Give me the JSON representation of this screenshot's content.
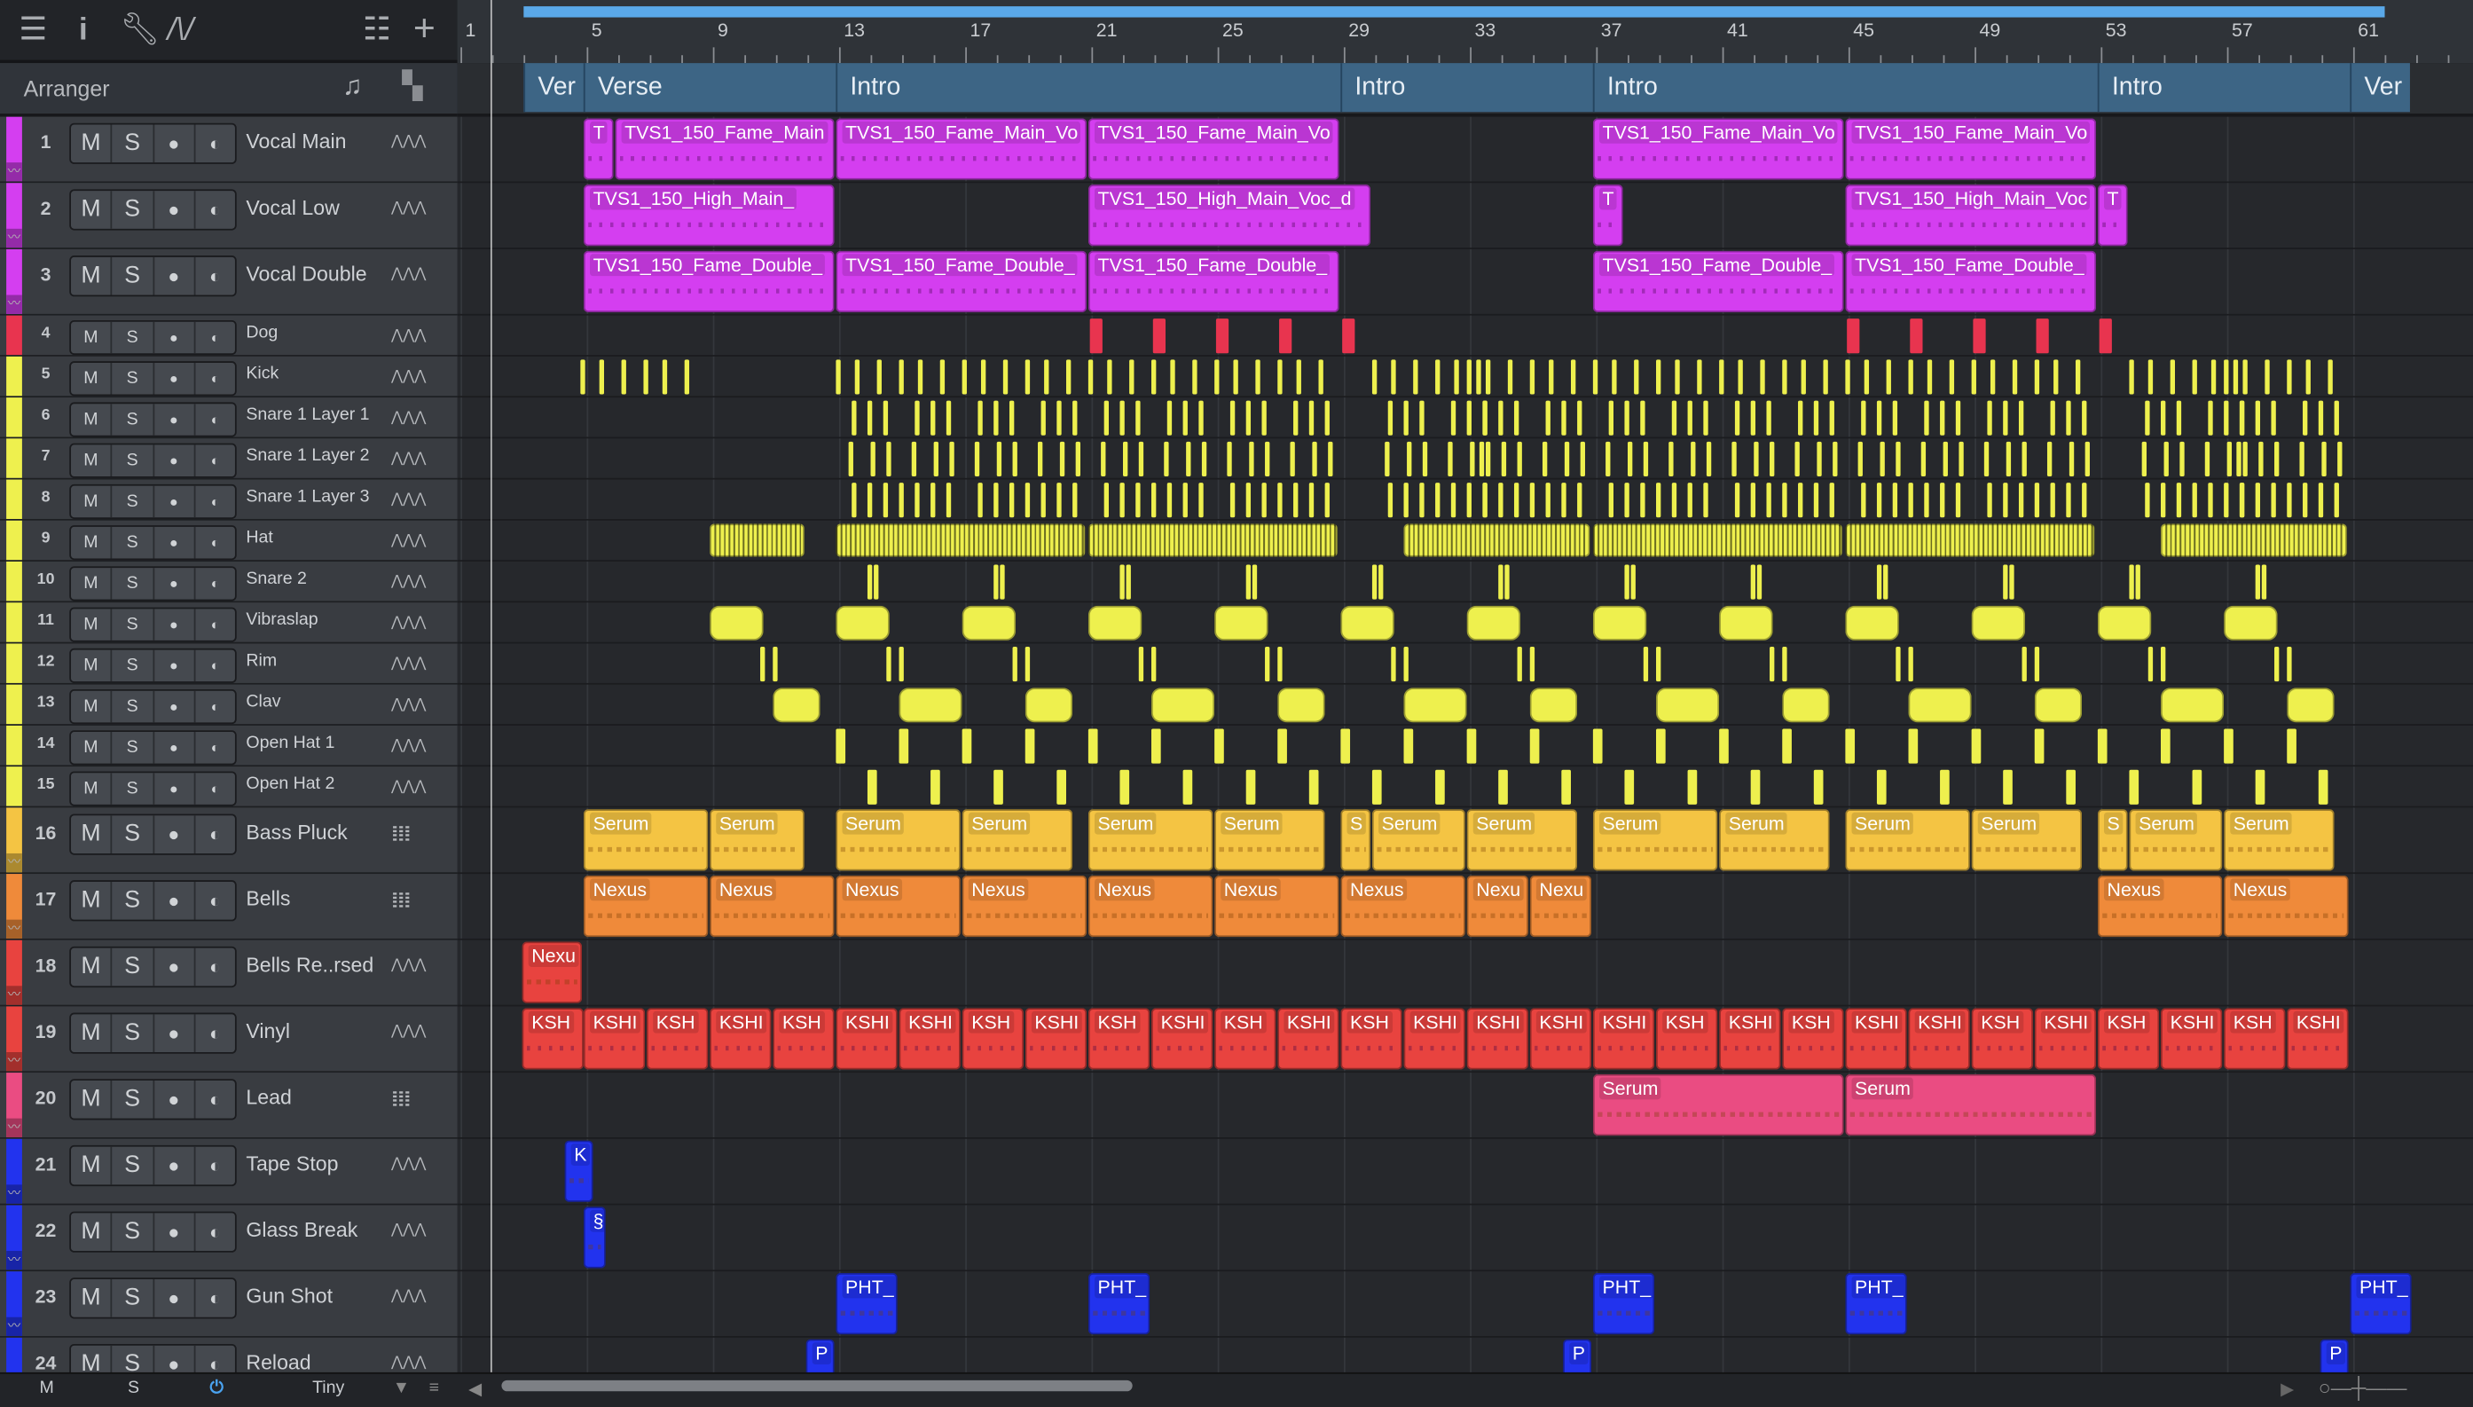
{
  "toolbar": {
    "icons": [
      "menu-icon",
      "info-icon",
      "wrench-icon",
      "automation-icon",
      "list-icon",
      "add-icon"
    ]
  },
  "arranger": {
    "label": "Arranger"
  },
  "ruler": {
    "bars": [
      "1",
      "5",
      "9",
      "13",
      "17",
      "21",
      "25",
      "29",
      "33",
      "37",
      "41",
      "45",
      "49",
      "53",
      "57",
      "61"
    ],
    "loop_start_bar": 3,
    "loop_end_bar": 62
  },
  "markers": [
    {
      "label": "Ver",
      "start": 3,
      "end": 4.9
    },
    {
      "label": "Verse",
      "start": 4.9,
      "end": 12.9
    },
    {
      "label": "Intro",
      "start": 12.9,
      "end": 28.9
    },
    {
      "label": "Intro",
      "start": 28.9,
      "end": 36.9
    },
    {
      "label": "Intro",
      "start": 36.9,
      "end": 52.9
    },
    {
      "label": "Intro",
      "start": 52.9,
      "end": 60.9
    },
    {
      "label": "Ver",
      "start": 60.9,
      "end": 62.8
    }
  ],
  "colors": {
    "purple": "#d43ef0",
    "dog": "#e8344f",
    "yellow": "#eef04e",
    "serum": "#f4c443",
    "nexus": "#ef8a3a",
    "red": "#e8433f",
    "lead": "#ea4c82",
    "blue": "#2233ee"
  },
  "buttons": {
    "mute": "M",
    "solo": "S",
    "record": "●",
    "monitor": "◐"
  },
  "tracks": [
    {
      "num": "1",
      "name": "Vocal Main",
      "color": "purple",
      "icon": "waveform",
      "clips": [
        {
          "s": 4.9,
          "l": 0.95,
          "t": "T"
        },
        {
          "s": 5.9,
          "l": 6.95,
          "t": "TVS1_150_Fame_Main"
        },
        {
          "s": 12.9,
          "l": 7.95,
          "t": "TVS1_150_Fame_Main_Vo"
        },
        {
          "s": 20.9,
          "l": 7.95,
          "t": "TVS1_150_Fame_Main_Vo"
        },
        {
          "s": 36.9,
          "l": 7.95,
          "t": "TVS1_150_Fame_Main_Vo"
        },
        {
          "s": 44.9,
          "l": 7.95,
          "t": "TVS1_150_Fame_Main_Vo"
        }
      ]
    },
    {
      "num": "2",
      "name": "Vocal Low",
      "color": "purple",
      "icon": "waveform",
      "clips": [
        {
          "s": 4.9,
          "l": 7.95,
          "t": "TVS1_150_High_Main_"
        },
        {
          "s": 20.9,
          "l": 8.95,
          "t": "TVS1_150_High_Main_Voc_d"
        },
        {
          "s": 36.9,
          "l": 0.95,
          "t": "T"
        },
        {
          "s": 44.9,
          "l": 7.95,
          "t": "TVS1_150_High_Main_Voc"
        },
        {
          "s": 52.9,
          "l": 0.95,
          "t": "T"
        }
      ]
    },
    {
      "num": "3",
      "name": "Vocal Double",
      "color": "purple",
      "icon": "waveform",
      "clips": [
        {
          "s": 4.9,
          "l": 7.95,
          "t": "TVS1_150_Fame_Double_"
        },
        {
          "s": 12.9,
          "l": 7.95,
          "t": "TVS1_150_Fame_Double_"
        },
        {
          "s": 20.9,
          "l": 7.95,
          "t": "TVS1_150_Fame_Double_"
        },
        {
          "s": 36.9,
          "l": 7.95,
          "t": "TVS1_150_Fame_Double_"
        },
        {
          "s": 44.9,
          "l": 7.95,
          "t": "TVS1_150_Fame_Double_"
        }
      ]
    },
    {
      "num": "4",
      "name": "Dog",
      "color": "dog",
      "icon": "waveform",
      "hits": {
        "w": 0.4,
        "blocks": [
          20.95,
          22.95,
          24.95,
          26.95,
          28.95,
          44.95,
          46.95,
          48.95,
          50.95,
          52.95
        ],
        "pattern": [
          0
        ]
      }
    },
    {
      "num": "5",
      "name": "Kick",
      "color": "yellow",
      "icon": "waveform",
      "hits": {
        "w": 0.1,
        "blocks": [
          4.8,
          12.9,
          16.9,
          20.9,
          24.9,
          29.9,
          32.9,
          36.9,
          40.9,
          44.9,
          48.9,
          53.9,
          56.9
        ],
        "pattern": [
          0,
          0.6,
          1.3,
          2,
          2.6,
          3.3
        ]
      }
    },
    {
      "num": "6",
      "name": "Snare 1 Layer 1",
      "color": "yellow",
      "icon": "waveform",
      "hits": {
        "w": 0.1,
        "blocks": [
          12.9,
          16.9,
          20.9,
          24.9,
          29.9,
          32.9,
          36.9,
          40.9,
          44.9,
          48.9,
          53.9,
          56.9
        ],
        "pattern": [
          0.5,
          1,
          1.5,
          2.5,
          3,
          3.5
        ]
      }
    },
    {
      "num": "7",
      "name": "Snare 1 Layer 2",
      "color": "yellow",
      "icon": "waveform",
      "hits": {
        "w": 0.1,
        "blocks": [
          12.9,
          16.9,
          20.9,
          24.9,
          29.9,
          32.9,
          36.9,
          40.9,
          44.9,
          48.9,
          53.9,
          56.9
        ],
        "pattern": [
          0.4,
          1.1,
          1.6,
          2.4,
          3.1,
          3.6
        ]
      }
    },
    {
      "num": "8",
      "name": "Snare 1 Layer 3",
      "color": "yellow",
      "icon": "waveform",
      "hits": {
        "w": 0.1,
        "blocks": [
          12.9,
          16.9,
          20.9,
          24.9,
          29.9,
          32.9,
          36.9,
          40.9,
          44.9,
          48.9,
          53.9,
          56.9
        ],
        "pattern": [
          0.5,
          1,
          1.5,
          2,
          2.5,
          3,
          3.5
        ]
      }
    },
    {
      "num": "9",
      "name": "Hat",
      "color": "yellow",
      "icon": "waveform",
      "clips": [
        {
          "s": 8.9,
          "l": 3,
          "t": "",
          "hat": true
        },
        {
          "s": 12.9,
          "l": 7.9,
          "t": "",
          "hat": true
        },
        {
          "s": 20.9,
          "l": 7.9,
          "t": "",
          "hat": true
        },
        {
          "s": 30.9,
          "l": 5.9,
          "t": "",
          "hat": true
        },
        {
          "s": 36.9,
          "l": 7.9,
          "t": "",
          "hat": true
        },
        {
          "s": 44.9,
          "l": 7.9,
          "t": "",
          "hat": true
        },
        {
          "s": 54.9,
          "l": 5.9,
          "t": "",
          "hat": true
        }
      ]
    },
    {
      "num": "10",
      "name": "Snare 2",
      "color": "yellow",
      "icon": "waveform",
      "hits": {
        "w": 0.1,
        "blocks": [
          12.9,
          20.9,
          28.9,
          36.9,
          44.9,
          52.9
        ],
        "pattern": [
          1,
          1.2,
          5,
          5.2
        ]
      }
    },
    {
      "num": "11",
      "name": "Vibraslap",
      "color": "yellow",
      "icon": "waveform",
      "clips": [
        {
          "s": 8.9,
          "l": 1.7,
          "t": ""
        },
        {
          "s": 12.9,
          "l": 1.7,
          "t": ""
        },
        {
          "s": 16.9,
          "l": 1.7,
          "t": ""
        },
        {
          "s": 20.9,
          "l": 1.7,
          "t": ""
        },
        {
          "s": 24.9,
          "l": 1.7,
          "t": ""
        },
        {
          "s": 28.9,
          "l": 1.7,
          "t": ""
        },
        {
          "s": 32.9,
          "l": 1.7,
          "t": ""
        },
        {
          "s": 36.9,
          "l": 1.7,
          "t": ""
        },
        {
          "s": 40.9,
          "l": 1.7,
          "t": ""
        },
        {
          "s": 44.9,
          "l": 1.7,
          "t": ""
        },
        {
          "s": 48.9,
          "l": 1.7,
          "t": ""
        },
        {
          "s": 52.9,
          "l": 1.7,
          "t": ""
        },
        {
          "s": 56.9,
          "l": 1.7,
          "t": ""
        }
      ]
    },
    {
      "num": "12",
      "name": "Rim",
      "color": "yellow",
      "icon": "waveform",
      "hits": {
        "w": 0.1,
        "blocks": [
          10.5,
          14.5,
          18.5,
          22.5,
          26.5,
          30.5,
          34.5,
          38.5,
          42.5,
          46.5,
          50.5,
          54.5,
          58.5
        ],
        "pattern": [
          0,
          0.4
        ]
      }
    },
    {
      "num": "13",
      "name": "Clav",
      "color": "yellow",
      "icon": "waveform",
      "clips": [
        {
          "s": 10.9,
          "l": 1.5,
          "t": ""
        },
        {
          "s": 14.9,
          "l": 2,
          "t": ""
        },
        {
          "s": 18.9,
          "l": 1.5,
          "t": ""
        },
        {
          "s": 22.9,
          "l": 2,
          "t": ""
        },
        {
          "s": 26.9,
          "l": 1.5,
          "t": ""
        },
        {
          "s": 30.9,
          "l": 2,
          "t": ""
        },
        {
          "s": 34.9,
          "l": 1.5,
          "t": ""
        },
        {
          "s": 38.9,
          "l": 2,
          "t": ""
        },
        {
          "s": 42.9,
          "l": 1.5,
          "t": ""
        },
        {
          "s": 46.9,
          "l": 2,
          "t": ""
        },
        {
          "s": 50.9,
          "l": 1.5,
          "t": ""
        },
        {
          "s": 54.9,
          "l": 2,
          "t": ""
        },
        {
          "s": 58.9,
          "l": 1.5,
          "t": ""
        }
      ]
    },
    {
      "num": "14",
      "name": "Open Hat 1",
      "color": "yellow",
      "icon": "waveform",
      "hits": {
        "w": 0.3,
        "blocks": [
          12.9,
          20.9,
          28.9,
          36.9,
          44.9,
          52.9
        ],
        "pattern": [
          0,
          2,
          4,
          6
        ]
      }
    },
    {
      "num": "15",
      "name": "Open Hat 2",
      "color": "yellow",
      "icon": "waveform",
      "hits": {
        "w": 0.3,
        "blocks": [
          12.9,
          20.9,
          28.9,
          36.9,
          44.9,
          52.9
        ],
        "pattern": [
          1,
          3,
          5,
          7
        ]
      }
    },
    {
      "num": "16",
      "name": "Bass Pluck",
      "color": "serum",
      "icon": "keyboard",
      "clips": [
        {
          "s": 4.9,
          "l": 3.95,
          "t": "Serum"
        },
        {
          "s": 8.9,
          "l": 3,
          "t": "Serum"
        },
        {
          "s": 12.9,
          "l": 3.95,
          "t": "Serum"
        },
        {
          "s": 16.9,
          "l": 3.5,
          "t": "Serum"
        },
        {
          "s": 20.9,
          "l": 3.95,
          "t": "Serum"
        },
        {
          "s": 24.9,
          "l": 3.5,
          "t": "Serum"
        },
        {
          "s": 28.9,
          "l": 0.95,
          "t": "S"
        },
        {
          "s": 29.9,
          "l": 2.95,
          "t": "Serum"
        },
        {
          "s": 32.9,
          "l": 3.5,
          "t": "Serum"
        },
        {
          "s": 36.9,
          "l": 3.95,
          "t": "Serum"
        },
        {
          "s": 40.9,
          "l": 3.5,
          "t": "Serum"
        },
        {
          "s": 44.9,
          "l": 3.95,
          "t": "Serum"
        },
        {
          "s": 48.9,
          "l": 3.5,
          "t": "Serum"
        },
        {
          "s": 52.9,
          "l": 0.95,
          "t": "S"
        },
        {
          "s": 53.9,
          "l": 2.95,
          "t": "Serum"
        },
        {
          "s": 56.9,
          "l": 3.5,
          "t": "Serum"
        }
      ]
    },
    {
      "num": "17",
      "name": "Bells",
      "color": "nexus",
      "icon": "keyboard",
      "clips": [
        {
          "s": 4.9,
          "l": 3.95,
          "t": "Nexus"
        },
        {
          "s": 8.9,
          "l": 3.95,
          "t": "Nexus"
        },
        {
          "s": 12.9,
          "l": 3.95,
          "t": "Nexus"
        },
        {
          "s": 16.9,
          "l": 3.95,
          "t": "Nexus"
        },
        {
          "s": 20.9,
          "l": 3.95,
          "t": "Nexus"
        },
        {
          "s": 24.9,
          "l": 3.95,
          "t": "Nexus"
        },
        {
          "s": 28.9,
          "l": 3.95,
          "t": "Nexus"
        },
        {
          "s": 32.9,
          "l": 1.95,
          "t": "Nexu"
        },
        {
          "s": 34.9,
          "l": 1.95,
          "t": "Nexu"
        },
        {
          "s": 52.9,
          "l": 3.95,
          "t": "Nexus"
        },
        {
          "s": 56.9,
          "l": 3.95,
          "t": "Nexus"
        }
      ]
    },
    {
      "num": "18",
      "name": "Bells Re..rsed",
      "color": "red",
      "icon": "waveform",
      "clips": [
        {
          "s": 2.95,
          "l": 1.9,
          "t": "Nexu"
        }
      ]
    },
    {
      "num": "19",
      "name": "Vinyl",
      "color": "red",
      "icon": "waveform",
      "clips": [
        {
          "s": 2.95,
          "l": 1.95,
          "t": "KSH"
        },
        {
          "s": 4.9,
          "l": 1.95,
          "t": "KSHI"
        },
        {
          "s": 6.9,
          "l": 1.95,
          "t": "KSH"
        },
        {
          "s": 8.9,
          "l": 1.95,
          "t": "KSHI"
        },
        {
          "s": 10.9,
          "l": 1.95,
          "t": "KSH"
        },
        {
          "s": 12.9,
          "l": 1.95,
          "t": "KSHI"
        },
        {
          "s": 14.9,
          "l": 1.95,
          "t": "KSHI"
        },
        {
          "s": 16.9,
          "l": 1.95,
          "t": "KSH"
        },
        {
          "s": 18.9,
          "l": 1.95,
          "t": "KSHI"
        },
        {
          "s": 20.9,
          "l": 1.95,
          "t": "KSH"
        },
        {
          "s": 22.9,
          "l": 1.95,
          "t": "KSHI"
        },
        {
          "s": 24.9,
          "l": 1.95,
          "t": "KSH"
        },
        {
          "s": 26.9,
          "l": 1.95,
          "t": "KSHI"
        },
        {
          "s": 28.9,
          "l": 1.95,
          "t": "KSH"
        },
        {
          "s": 30.9,
          "l": 1.95,
          "t": "KSHI"
        },
        {
          "s": 32.9,
          "l": 1.95,
          "t": "KSHI"
        },
        {
          "s": 34.9,
          "l": 1.95,
          "t": "KSHI"
        },
        {
          "s": 36.9,
          "l": 1.95,
          "t": "KSHI"
        },
        {
          "s": 38.9,
          "l": 1.95,
          "t": "KSH"
        },
        {
          "s": 40.9,
          "l": 1.95,
          "t": "KSHI"
        },
        {
          "s": 42.9,
          "l": 1.95,
          "t": "KSH"
        },
        {
          "s": 44.9,
          "l": 1.95,
          "t": "KSHI"
        },
        {
          "s": 46.9,
          "l": 1.95,
          "t": "KSHI"
        },
        {
          "s": 48.9,
          "l": 1.95,
          "t": "KSH"
        },
        {
          "s": 50.9,
          "l": 1.95,
          "t": "KSHI"
        },
        {
          "s": 52.9,
          "l": 1.95,
          "t": "KSH"
        },
        {
          "s": 54.9,
          "l": 1.95,
          "t": "KSHI"
        },
        {
          "s": 56.9,
          "l": 1.95,
          "t": "KSH"
        },
        {
          "s": 58.9,
          "l": 1.95,
          "t": "KSHI"
        }
      ]
    },
    {
      "num": "20",
      "name": "Lead",
      "color": "lead",
      "icon": "keyboard",
      "clips": [
        {
          "s": 36.9,
          "l": 7.95,
          "t": "Serum"
        },
        {
          "s": 44.9,
          "l": 7.95,
          "t": "Serum"
        }
      ]
    },
    {
      "num": "21",
      "name": "Tape Stop",
      "color": "blue",
      "icon": "waveform",
      "clips": [
        {
          "s": 4.3,
          "l": 0.9,
          "t": "K"
        }
      ]
    },
    {
      "num": "22",
      "name": "Glass Break",
      "color": "blue",
      "icon": "waveform",
      "clips": [
        {
          "s": 4.9,
          "l": 0.7,
          "t": "§"
        }
      ]
    },
    {
      "num": "23",
      "name": "Gun Shot",
      "color": "blue",
      "icon": "waveform",
      "clips": [
        {
          "s": 12.9,
          "l": 1.95,
          "t": "PHT_"
        },
        {
          "s": 20.9,
          "l": 1.95,
          "t": "PHT_"
        },
        {
          "s": 36.9,
          "l": 1.95,
          "t": "PHT_"
        },
        {
          "s": 44.9,
          "l": 1.95,
          "t": "PHT_"
        },
        {
          "s": 60.9,
          "l": 1.95,
          "t": "PHT_"
        }
      ]
    },
    {
      "num": "24",
      "name": "Reload",
      "color": "blue",
      "icon": "waveform",
      "clips": [
        {
          "s": 11.95,
          "l": 0.9,
          "t": "P"
        },
        {
          "s": 35.95,
          "l": 0.9,
          "t": "P"
        },
        {
          "s": 59.95,
          "l": 0.9,
          "t": "P"
        }
      ]
    }
  ],
  "bottom": {
    "mute": "M",
    "solo": "S",
    "size": "Tiny"
  }
}
